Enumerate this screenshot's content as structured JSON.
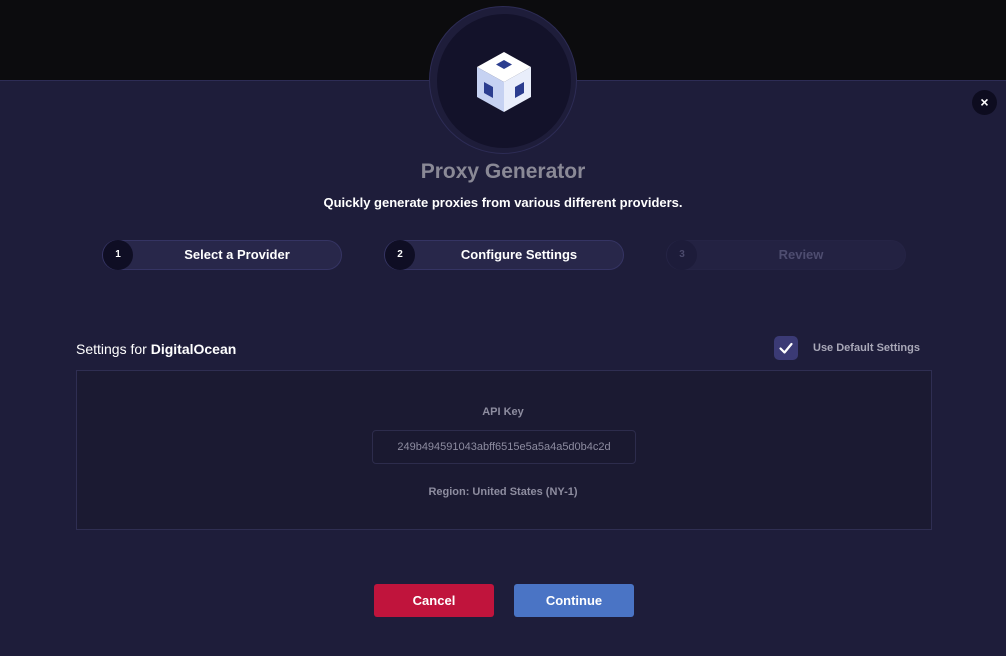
{
  "header": {
    "title": "Proxy Generator",
    "subtitle": "Quickly generate proxies from various different providers.",
    "close_symbol": "×"
  },
  "icons": {
    "logo": "cube-icon",
    "close": "close-icon",
    "checkbox": "checkmark-icon"
  },
  "steps": [
    {
      "number": "1",
      "label": "Select a Provider",
      "state": "complete"
    },
    {
      "number": "2",
      "label": "Configure Settings",
      "state": "active"
    },
    {
      "number": "3",
      "label": "Review",
      "state": "inactive"
    }
  ],
  "settings": {
    "heading_prefix": "Settings for",
    "provider": "DigitalOcean",
    "use_default_label": "Use Default Settings",
    "use_default_checked": true,
    "api_key_label": "API Key",
    "api_key_value": "249b494591043abff6515e5a5a4a5d0b4c2d",
    "region": "Region: United States (NY-1)"
  },
  "actions": {
    "cancel_label": "Cancel",
    "continue_label": "Continue"
  },
  "colors": {
    "modal_bg": "#1e1d3a",
    "cancel": "#c0143c",
    "continue": "#4a74c5",
    "checkbox": "#3b3a75"
  }
}
